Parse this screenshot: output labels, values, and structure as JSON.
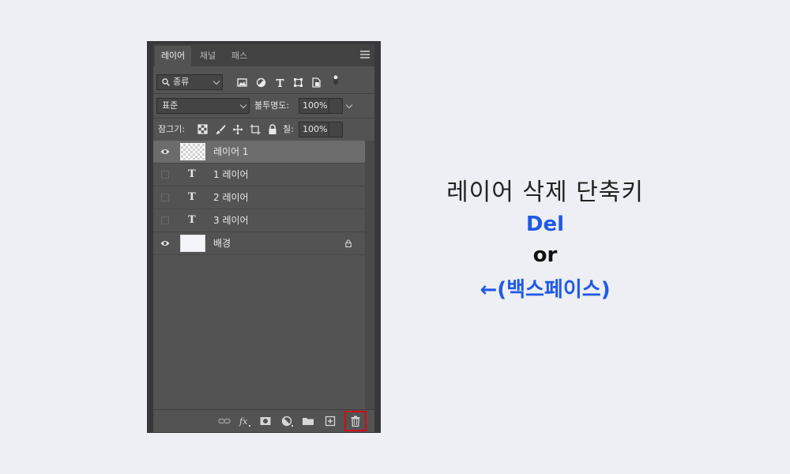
{
  "panel": {
    "tabs": [
      "레이어",
      "채널",
      "패스"
    ],
    "filter": {
      "label": "종류"
    },
    "blend_mode": "표준",
    "opacity": {
      "label": "불투명도:",
      "value": "100%"
    },
    "lock": {
      "label": "잠그기:"
    },
    "fill": {
      "label": "칠:",
      "value": "100%"
    },
    "layers": [
      {
        "name": "레이어 1",
        "type": "pixel",
        "visible": true,
        "selected": true
      },
      {
        "name": "1 레이어",
        "type": "text",
        "visible": false,
        "selected": false
      },
      {
        "name": "2 레이어",
        "type": "text",
        "visible": false,
        "selected": false
      },
      {
        "name": "3 레이어",
        "type": "text",
        "visible": false,
        "selected": false
      },
      {
        "name": "배경",
        "type": "background",
        "visible": true,
        "selected": false,
        "locked": true
      }
    ],
    "footer_icons": [
      "link-icon",
      "fx-icon",
      "mask-icon",
      "adjustment-icon",
      "folder-icon",
      "new-layer-icon",
      "trash-icon"
    ]
  },
  "info": {
    "title": "레이어 삭제 단축키",
    "key1": "Del",
    "or": "or",
    "key2": "←(백스페이스)"
  },
  "colors": {
    "accent_blue": "#1f5ae6",
    "highlight_red": "#d10c16",
    "background": "#eeeff4"
  }
}
